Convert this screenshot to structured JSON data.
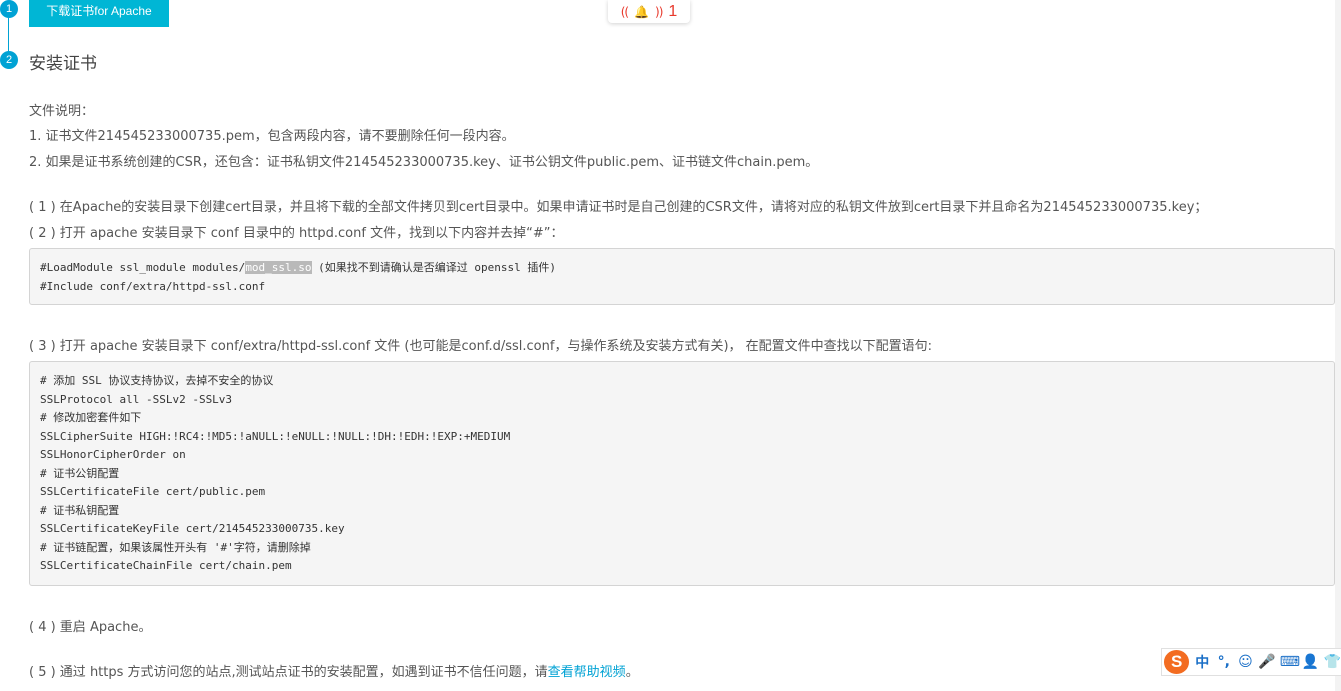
{
  "steps": {
    "step1_num": "1",
    "step2_num": "2",
    "download_button": "下载证书for Apache",
    "step2_title": "安装证书"
  },
  "notification": {
    "count": "1"
  },
  "files": {
    "heading": "文件说明：",
    "item1": "1. 证书文件214545233000735.pem，包含两段内容，请不要删除任何一段内容。",
    "item2": "2. 如果是证书系统创建的CSR，还包含：证书私钥文件214545233000735.key、证书公钥文件public.pem、证书链文件chain.pem。"
  },
  "instructions": {
    "s1": "( 1 ) 在Apache的安装目录下创建cert目录，并且将下载的全部文件拷贝到cert目录中。如果申请证书时是自己创建的CSR文件，请将对应的私钥文件放到cert目录下并且命名为214545233000735.key；",
    "s2": "( 2 ) 打开 apache 安装目录下 conf 目录中的 httpd.conf 文件，找到以下内容并去掉“#”：",
    "s3": "( 3 ) 打开 apache 安装目录下 conf/extra/httpd-ssl.conf 文件 (也可能是conf.d/ssl.conf，与操作系统及安装方式有关)， 在配置文件中查找以下配置语句:",
    "s4": "( 4 ) 重启 Apache。",
    "s5_prefix": "( 5 ) 通过 https 方式访问您的站点,测试站点证书的安装配置，如遇到证书不信任问题，请",
    "s5_link": "查看帮助视频",
    "s5_suffix": "。"
  },
  "code1": {
    "l1_pre": "#LoadModule ssl_module modules/",
    "l1_hl": "mod_ssl.so",
    "l1_post": " (如果找不到请确认是否编译过 openssl 插件)",
    "l2": "#Include conf/extra/httpd-ssl.conf"
  },
  "code2": {
    "lines": [
      "# 添加 SSL 协议支持协议，去掉不安全的协议",
      "SSLProtocol all -SSLv2 -SSLv3",
      "# 修改加密套件如下",
      "SSLCipherSuite HIGH:!RC4:!MD5:!aNULL:!eNULL:!NULL:!DH:!EDH:!EXP:+MEDIUM",
      "SSLHonorCipherOrder on",
      "# 证书公钥配置",
      "SSLCertificateFile cert/public.pem",
      "# 证书私钥配置",
      "SSLCertificateKeyFile cert/214545233000735.key",
      "# 证书链配置，如果该属性开头有 '#'字符，请删除掉",
      "SSLCertificateChainFile cert/chain.pem"
    ]
  },
  "ime": {
    "logo": "S",
    "items": [
      "中",
      "°,",
      "☺",
      "🎤",
      "⌨",
      "👤",
      "👕"
    ]
  },
  "colors": {
    "accent": "#00a2d4",
    "button": "#00b6d5",
    "alert": "#e8392c"
  }
}
